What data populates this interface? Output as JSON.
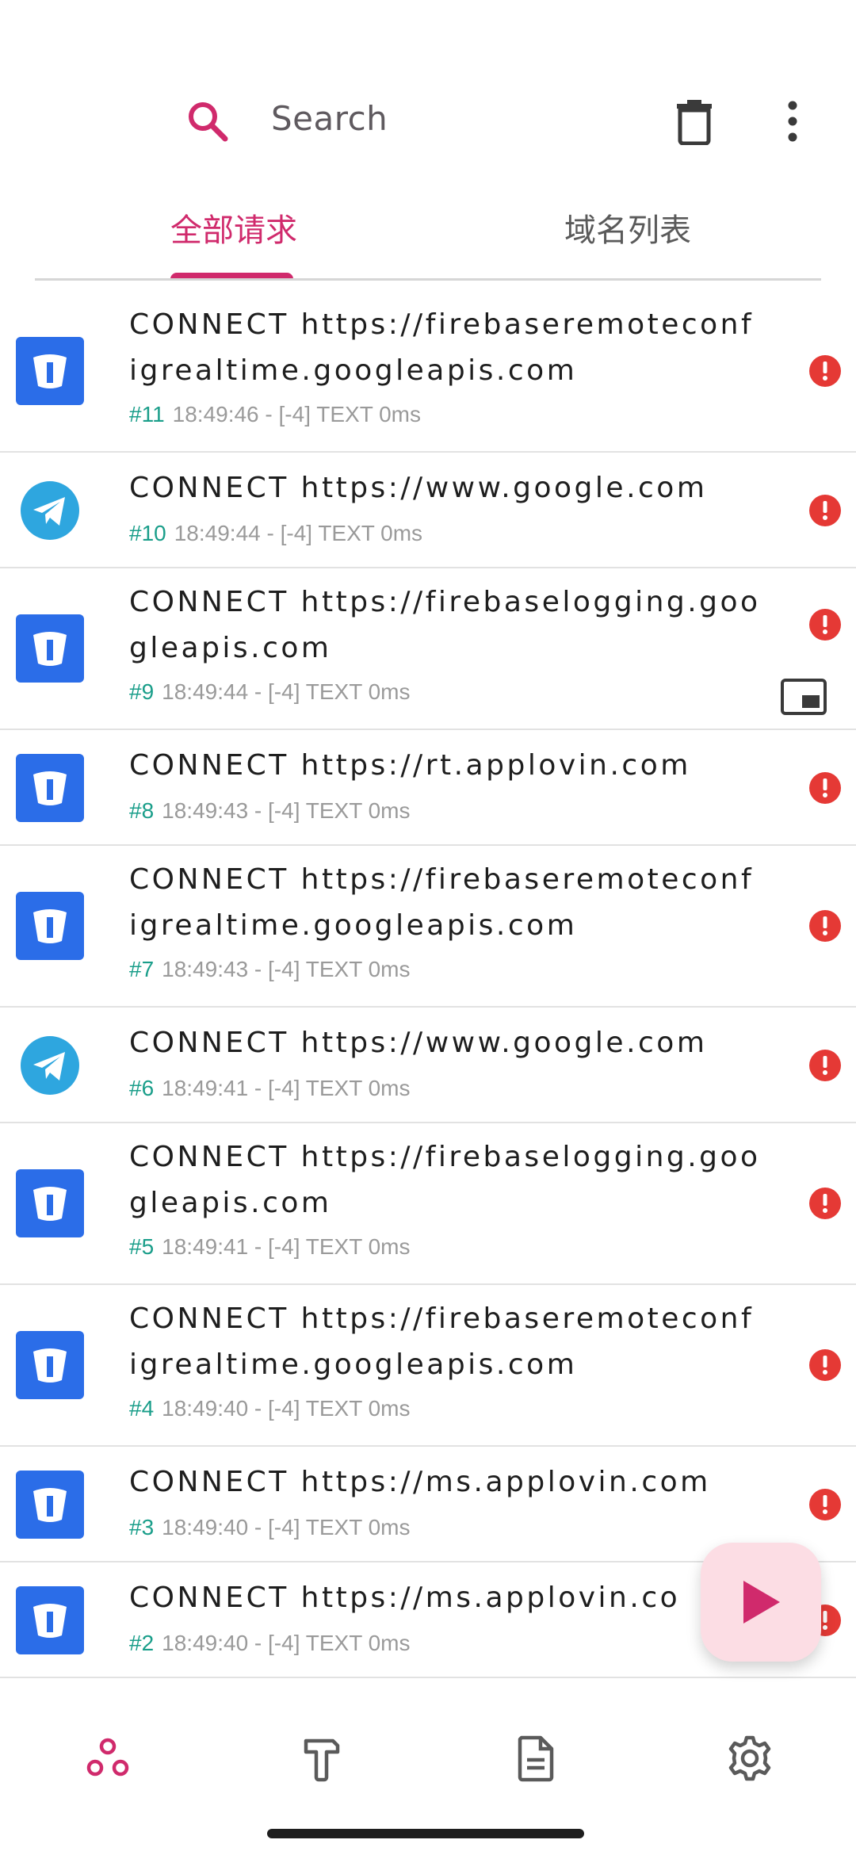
{
  "search": {
    "placeholder": "Search"
  },
  "tabs": [
    {
      "label": "全部请求",
      "active": true
    },
    {
      "label": "域名列表",
      "active": false
    }
  ],
  "colors": {
    "accent": "#d02a6c",
    "id_green": "#1a9e8a",
    "error_red": "#e53935",
    "app_blue": "#2b6de8",
    "telegram_blue": "#2ea6df"
  },
  "requests": [
    {
      "app": "app-t-icon",
      "title": "CONNECT https://firebaseremoteconfigrealtime.googleapis.com",
      "id": "#11",
      "meta": "18:49:46 - [-4] TEXT  0ms"
    },
    {
      "app": "telegram-icon",
      "title": "CONNECT https://www.google.com",
      "id": "#10",
      "meta": "18:49:44 - [-4] TEXT  0ms"
    },
    {
      "app": "app-t-icon",
      "title": "CONNECT https://firebaselogging.googleapis.com",
      "id": "#9",
      "meta": "18:49:44 - [-4] TEXT  0ms"
    },
    {
      "app": "app-t-icon",
      "title": "CONNECT https://rt.applovin.com",
      "id": "#8",
      "meta": "18:49:43 - [-4] TEXT  0ms"
    },
    {
      "app": "app-t-icon",
      "title": "CONNECT https://firebaseremoteconfigrealtime.googleapis.com",
      "id": "#7",
      "meta": "18:49:43 - [-4] TEXT  0ms"
    },
    {
      "app": "telegram-icon",
      "title": "CONNECT https://www.google.com",
      "id": "#6",
      "meta": "18:49:41 - [-4] TEXT  0ms"
    },
    {
      "app": "app-t-icon",
      "title": "CONNECT https://firebaselogging.googleapis.com",
      "id": "#5",
      "meta": "18:49:41 - [-4] TEXT  0ms"
    },
    {
      "app": "app-t-icon",
      "title": "CONNECT https://firebaseremoteconfigrealtime.googleapis.com",
      "id": "#4",
      "meta": "18:49:40 - [-4] TEXT  0ms"
    },
    {
      "app": "app-t-icon",
      "title": "CONNECT https://ms.applovin.com",
      "id": "#3",
      "meta": "18:49:40 - [-4] TEXT  0ms"
    },
    {
      "app": "app-t-icon",
      "title": "CONNECT https://ms.applovin.co",
      "id": "#2",
      "meta": "18:49:40 - [-4] TEXT  0ms"
    }
  ],
  "bottom_nav": [
    {
      "icon": "network-icon",
      "active": true
    },
    {
      "icon": "hammer-icon",
      "active": false
    },
    {
      "icon": "document-icon",
      "active": false
    },
    {
      "icon": "settings-gear-icon",
      "active": false
    }
  ]
}
